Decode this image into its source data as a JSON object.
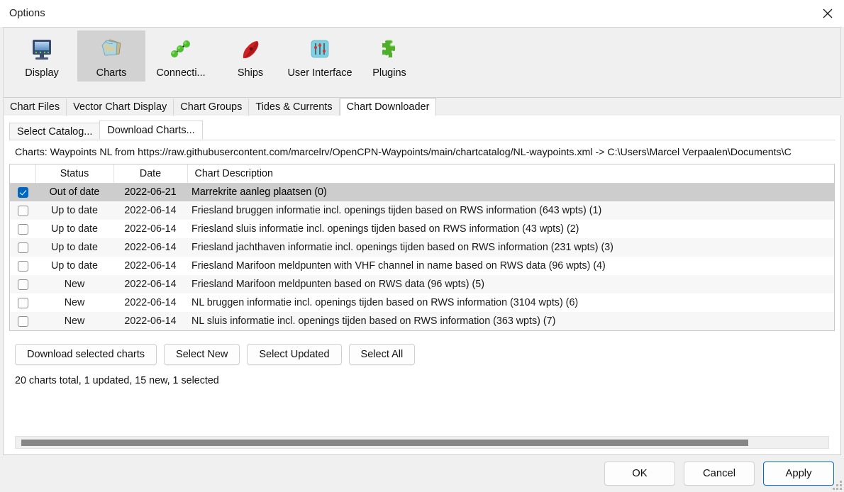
{
  "window": {
    "title": "Options",
    "close_icon": "close-icon"
  },
  "toolbar": {
    "items": [
      {
        "label": "Display",
        "icon": "monitor-icon",
        "selected": false
      },
      {
        "label": "Charts",
        "icon": "charts-icon",
        "selected": true
      },
      {
        "label": "Connecti...",
        "icon": "connections-icon",
        "selected": false
      },
      {
        "label": "Ships",
        "icon": "ship-icon",
        "selected": false
      },
      {
        "label": "User Interface",
        "icon": "sliders-icon",
        "selected": false
      },
      {
        "label": "Plugins",
        "icon": "puzzle-icon",
        "selected": false
      }
    ]
  },
  "outer_tabs": [
    {
      "label": "Chart Files",
      "active": false
    },
    {
      "label": "Vector Chart Display",
      "active": false
    },
    {
      "label": "Chart Groups",
      "active": false
    },
    {
      "label": "Tides & Currents",
      "active": false
    },
    {
      "label": "Chart Downloader",
      "active": true
    }
  ],
  "inner_tabs": [
    {
      "label": "Select Catalog...",
      "active": false
    },
    {
      "label": "Download Charts...",
      "active": true
    }
  ],
  "catalog_line": "Charts: Waypoints NL from https://raw.githubusercontent.com/marcelrv/OpenCPN-Waypoints/main/chartcatalog/NL-waypoints.xml -> C:\\Users\\Marcel Verpaalen\\Documents\\C",
  "table": {
    "columns": [
      "",
      "Status",
      "Date",
      "Chart Description"
    ],
    "rows": [
      {
        "checked": true,
        "selected": true,
        "status": "Out of date",
        "date": "2022-06-21",
        "description": "Marrekrite aanleg plaatsen (0)"
      },
      {
        "checked": false,
        "selected": false,
        "status": "Up to date",
        "date": "2022-06-14",
        "description": "Friesland bruggen informatie incl. openings tijden based on RWS information (643 wpts) (1)"
      },
      {
        "checked": false,
        "selected": false,
        "status": "Up to date",
        "date": "2022-06-14",
        "description": "Friesland sluis informatie incl. openings tijden based on RWS information (43 wpts) (2)"
      },
      {
        "checked": false,
        "selected": false,
        "status": "Up to date",
        "date": "2022-06-14",
        "description": "Friesland jachthaven informatie incl. openings tijden based on RWS information (231 wpts) (3)"
      },
      {
        "checked": false,
        "selected": false,
        "status": "Up to date",
        "date": "2022-06-14",
        "description": "Friesland Marifoon meldpunten with VHF channel in name based on RWS data (96 wpts) (4)"
      },
      {
        "checked": false,
        "selected": false,
        "status": "New",
        "date": "2022-06-14",
        "description": "Friesland Marifoon meldpunten based on RWS data (96 wpts) (5)"
      },
      {
        "checked": false,
        "selected": false,
        "status": "New",
        "date": "2022-06-14",
        "description": "NL bruggen informatie incl. openings tijden based on RWS information (3104 wpts) (6)"
      },
      {
        "checked": false,
        "selected": false,
        "status": "New",
        "date": "2022-06-14",
        "description": "NL sluis informatie incl. openings tijden based on RWS information (363 wpts) (7)"
      }
    ]
  },
  "actions": {
    "download": "Download selected charts",
    "select_new": "Select New",
    "select_updated": "Select Updated",
    "select_all": "Select All"
  },
  "summary": "20 charts total, 1 updated, 15 new, 1 selected",
  "footer": {
    "ok": "OK",
    "cancel": "Cancel",
    "apply": "Apply"
  },
  "colors": {
    "accent": "#0067c0",
    "default_button_border": "#0a68c8",
    "selected_row": "#cdcdcd",
    "alt_row": "#f7f7f7",
    "scrollbar_thumb": "#868686"
  }
}
